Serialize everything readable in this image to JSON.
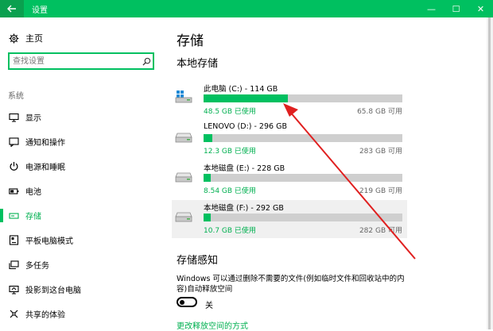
{
  "window": {
    "title": "设置",
    "minimize_glyph": "—",
    "maximize_glyph": "☐",
    "close_glyph": "✕"
  },
  "sidebar": {
    "home_label": "主页",
    "search_placeholder": "查找设置",
    "section_label": "系统",
    "items": [
      {
        "label": "显示",
        "icon": "display-icon",
        "active": false
      },
      {
        "label": "通知和操作",
        "icon": "notification-icon",
        "active": false
      },
      {
        "label": "电源和睡眠",
        "icon": "power-icon",
        "active": false
      },
      {
        "label": "电池",
        "icon": "battery-icon",
        "active": false
      },
      {
        "label": "存储",
        "icon": "storage-icon",
        "active": true
      },
      {
        "label": "平板电脑模式",
        "icon": "tablet-icon",
        "active": false
      },
      {
        "label": "多任务",
        "icon": "multitask-icon",
        "active": false
      },
      {
        "label": "投影到这台电脑",
        "icon": "project-icon",
        "active": false
      },
      {
        "label": "共享的体验",
        "icon": "share-icon",
        "active": false
      }
    ]
  },
  "main": {
    "title": "存储",
    "local_storage_title": "本地存储",
    "drives": [
      {
        "name": "此电脑 (C:) - 114 GB",
        "used": "48.5 GB 已使用",
        "free": "65.8 GB 可用",
        "used_fraction": 0.425,
        "system": true
      },
      {
        "name": "LENOVO (D:) - 296 GB",
        "used": "12.3 GB 已使用",
        "free": "283 GB 可用",
        "used_fraction": 0.042,
        "system": false
      },
      {
        "name": "本地磁盘 (E:) - 228 GB",
        "used": "8.54 GB 已使用",
        "free": "219 GB 可用",
        "used_fraction": 0.037,
        "system": false
      },
      {
        "name": "本地磁盘 (F:) - 292 GB",
        "used": "10.7 GB 已使用",
        "free": "282 GB 可用",
        "used_fraction": 0.037,
        "system": false
      }
    ],
    "storage_sense_title": "存储感知",
    "storage_sense_desc": "Windows 可以通过删除不需要的文件(例如临时文件和回收站中的内容)自动释放空间",
    "toggle_label": "关",
    "toggle_on": false,
    "link_label": "更改释放空间的方式"
  },
  "colors": {
    "accent": "#00c060",
    "arrow": "#e02020"
  }
}
